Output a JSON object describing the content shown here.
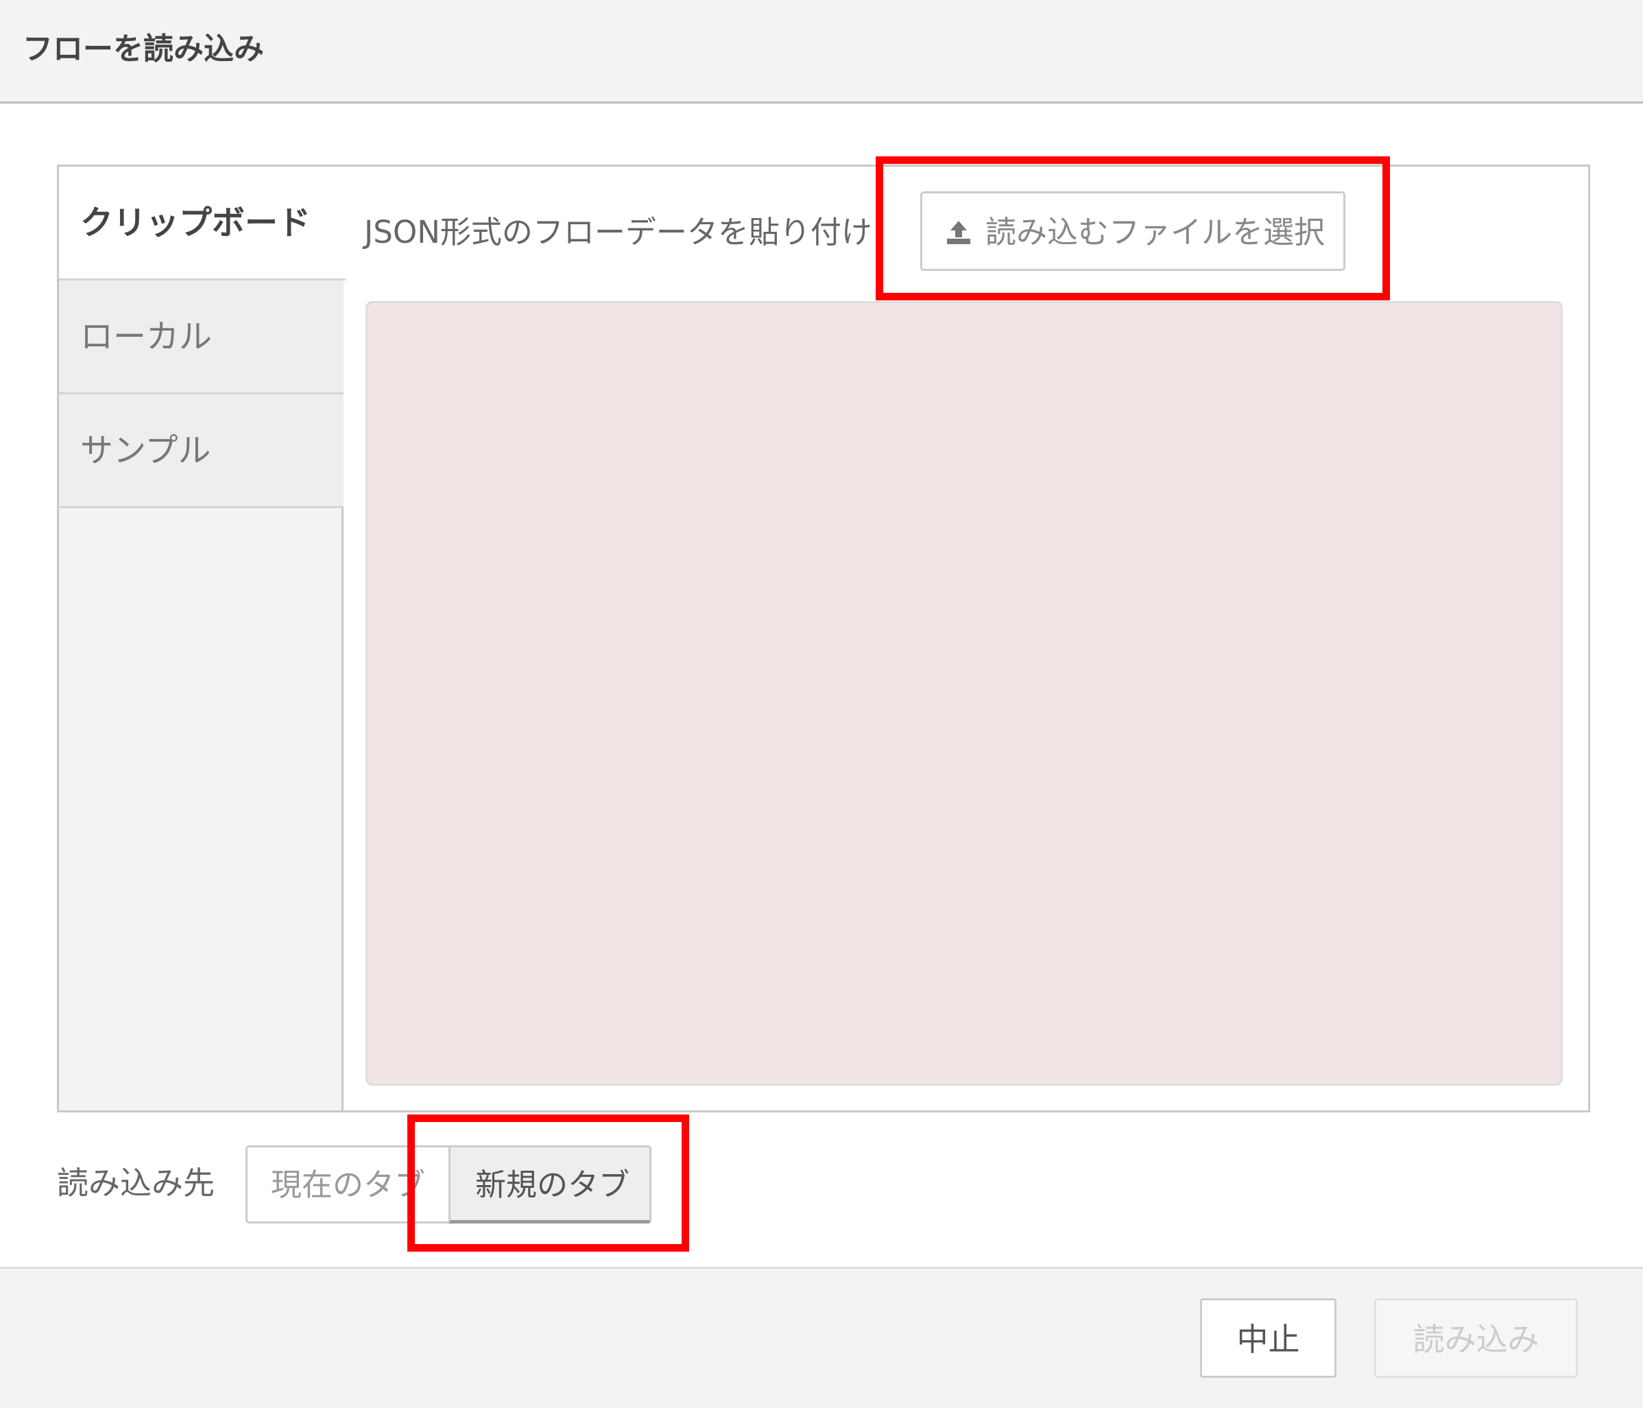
{
  "dialog": {
    "title": "フローを読み込み"
  },
  "side_tabs": [
    {
      "label": "クリップボード",
      "active": true
    },
    {
      "label": "ローカル",
      "active": false
    },
    {
      "label": "サンプル",
      "active": false
    }
  ],
  "clipboard": {
    "paste_label": "JSON形式のフローデータを貼り付け",
    "file_button": {
      "icon": "upload-icon",
      "label": "読み込むファイルを選択"
    },
    "textarea_value": ""
  },
  "import_target": {
    "label": "読み込み先",
    "options": [
      {
        "label": "現在のタブ",
        "selected": false
      },
      {
        "label": "新規のタブ",
        "selected": true
      }
    ]
  },
  "footer": {
    "cancel_label": "中止",
    "import_label": "読み込み",
    "import_disabled": true
  },
  "colors": {
    "highlight": "#ff0000",
    "textarea_bg": "#f3e5e5",
    "header_bg": "#f3f3f3"
  }
}
